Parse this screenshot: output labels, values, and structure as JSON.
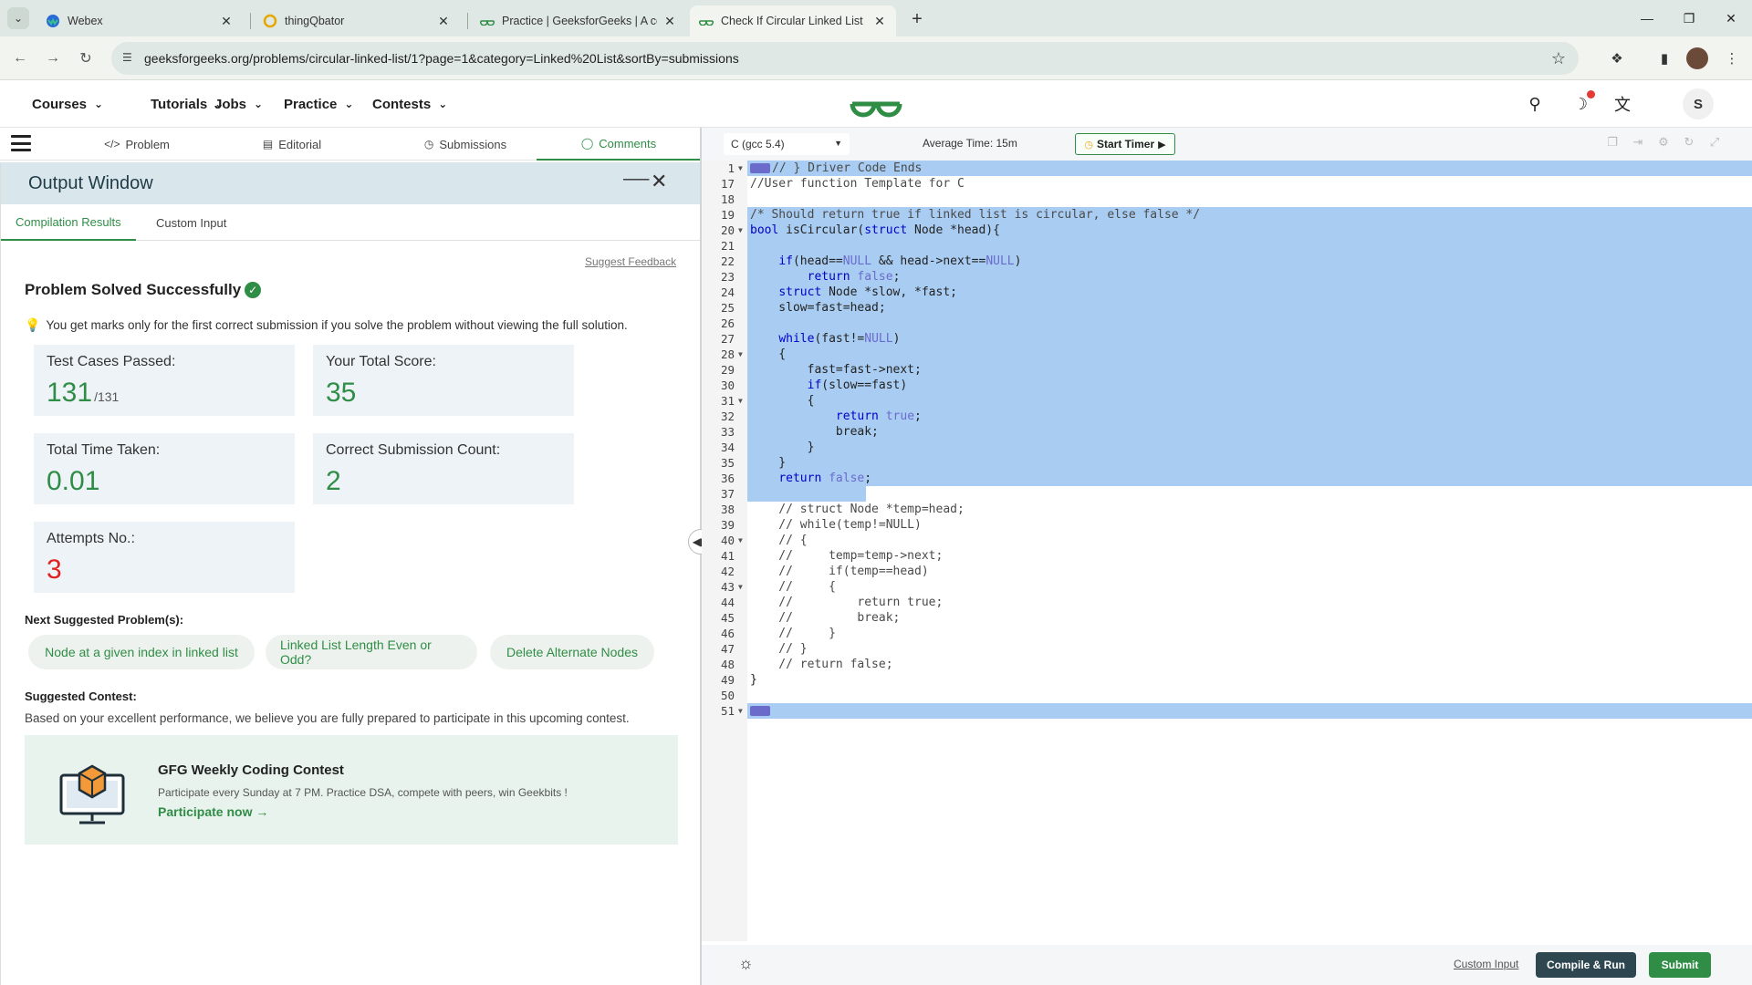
{
  "browser": {
    "tabs": [
      {
        "title": "Webex",
        "icon": "webex-icon"
      },
      {
        "title": "thingQbator",
        "icon": "thingqbator-icon"
      },
      {
        "title": "Practice | GeeksforGeeks | A co",
        "icon": "gfg-icon"
      },
      {
        "title": "Check If Circular Linked List | Pr",
        "icon": "gfg-icon",
        "active": true
      }
    ],
    "url": "geeksforgeeks.org/problems/circular-linked-list/1?page=1&category=Linked%20List&sortBy=submissions"
  },
  "header": {
    "nav": [
      "Courses",
      "Tutorials",
      "Jobs",
      "Practice",
      "Contests"
    ],
    "avatar_letter": "S"
  },
  "left_tabs": [
    "Problem",
    "Editorial",
    "Submissions",
    "Comments"
  ],
  "output_window": {
    "title": "Output Window",
    "subtabs": [
      "Compilation Results",
      "Custom Input"
    ],
    "suggest_feedback": "Suggest Feedback",
    "result_title": "Problem Solved Successfully",
    "note": "You get marks only for the first correct submission if you solve the problem without viewing the full solution.",
    "stats": {
      "test_cases_label": "Test Cases Passed:",
      "test_cases_value": "131",
      "test_cases_total": "/131",
      "score_label": "Your Total Score:",
      "score_value": "35",
      "time_label": "Total Time Taken:",
      "time_value": "0.01",
      "correct_label": "Correct Submission Count:",
      "correct_value": "2",
      "attempts_label": "Attempts No.:",
      "attempts_value": "3"
    },
    "next_label": "Next Suggested Problem(s):",
    "suggested": [
      "Node at a given index in linked list",
      "Linked List Length Even or Odd?",
      "Delete Alternate Nodes"
    ],
    "contest_label": "Suggested Contest:",
    "contest_desc": "Based on your excellent performance, we believe you are fully prepared to participate in this upcoming contest.",
    "contest_title": "GFG Weekly Coding Contest",
    "contest_sub": "Participate every Sunday at 7 PM. Practice DSA, compete with peers, win Geekbits !",
    "contest_cta": "Participate now →"
  },
  "editor": {
    "language": "C (gcc 5.4)",
    "avg_time": "Average Time: 15m",
    "start_timer": "Start Timer",
    "custom_input": "Custom Input",
    "compile_run": "Compile & Run",
    "submit": "Submit",
    "lines": [
      {
        "n": "1",
        "fold": true,
        "marker": true,
        "text": "// } Driver Code Ends"
      },
      {
        "n": "17",
        "text": "//User function Template for C"
      },
      {
        "n": "18",
        "text": ""
      },
      {
        "n": "19",
        "text": "/* Should return true if linked list is circular, else false */"
      },
      {
        "n": "20",
        "fold": true,
        "text": "bool isCircular(struct Node *head){"
      },
      {
        "n": "21",
        "text": ""
      },
      {
        "n": "22",
        "text": "    if(head==NULL && head->next==NULL)"
      },
      {
        "n": "23",
        "text": "        return false;"
      },
      {
        "n": "24",
        "text": "    struct Node *slow, *fast;"
      },
      {
        "n": "25",
        "text": "    slow=fast=head;"
      },
      {
        "n": "26",
        "text": ""
      },
      {
        "n": "27",
        "text": "    while(fast!=NULL)"
      },
      {
        "n": "28",
        "fold": true,
        "text": "    {"
      },
      {
        "n": "29",
        "text": "        fast=fast->next;"
      },
      {
        "n": "30",
        "text": "        if(slow==fast)"
      },
      {
        "n": "31",
        "fold": true,
        "text": "        {"
      },
      {
        "n": "32",
        "text": "            return true;"
      },
      {
        "n": "33",
        "text": "            break;"
      },
      {
        "n": "34",
        "text": "        }"
      },
      {
        "n": "35",
        "text": "    }"
      },
      {
        "n": "36",
        "text": "    return false;"
      },
      {
        "n": "37",
        "text": ""
      },
      {
        "n": "38",
        "text": "    // struct Node *temp=head;"
      },
      {
        "n": "39",
        "text": "    // while(temp!=NULL)"
      },
      {
        "n": "40",
        "fold": true,
        "text": "    // {"
      },
      {
        "n": "41",
        "text": "    //     temp=temp->next;"
      },
      {
        "n": "42",
        "text": "    //     if(temp==head)"
      },
      {
        "n": "43",
        "fold": true,
        "text": "    //     {"
      },
      {
        "n": "44",
        "text": "    //         return true;"
      },
      {
        "n": "45",
        "text": "    //         break;"
      },
      {
        "n": "46",
        "text": "    //     }"
      },
      {
        "n": "47",
        "text": "    // }"
      },
      {
        "n": "48",
        "text": "    // return false;"
      },
      {
        "n": "49",
        "text": "}"
      },
      {
        "n": "50",
        "text": ""
      },
      {
        "n": "51",
        "fold": true,
        "marker": true,
        "text": ""
      }
    ]
  }
}
